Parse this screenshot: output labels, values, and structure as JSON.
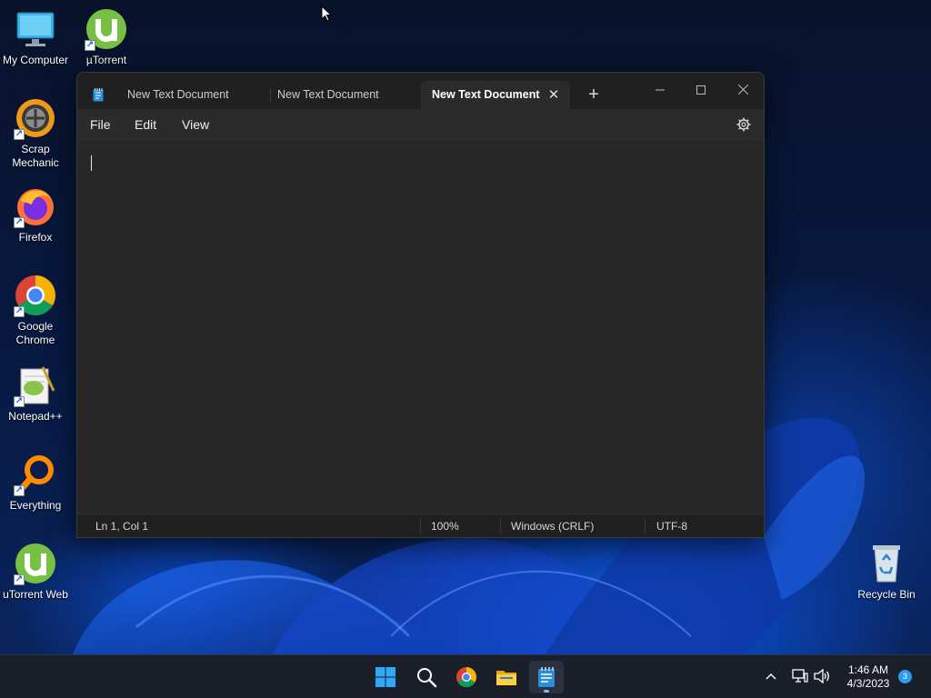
{
  "desktop": {
    "icons": [
      {
        "label": "My Computer",
        "icon": "computer-icon"
      },
      {
        "label": "µTorrent",
        "icon": "utorrent-icon"
      },
      {
        "label": "Scrap Mechanic",
        "icon": "scrap-mechanic-icon"
      },
      {
        "label": "Firefox",
        "icon": "firefox-icon"
      },
      {
        "label": "Google Chrome",
        "icon": "chrome-icon"
      },
      {
        "label": "Notepad++",
        "icon": "notepad-plus-plus-icon"
      },
      {
        "label": "Everything",
        "icon": "everything-search-icon"
      },
      {
        "label": "uTorrent Web",
        "icon": "utorrent-web-icon"
      },
      {
        "label": "Recycle Bin",
        "icon": "recycle-bin-icon"
      }
    ]
  },
  "notepad": {
    "tabs": [
      {
        "label": "New Text Document",
        "active": false
      },
      {
        "label": "New Text Document",
        "active": false
      },
      {
        "label": "New Text Document",
        "active": true
      }
    ],
    "menu": [
      "File",
      "Edit",
      "View"
    ],
    "content": "",
    "status": {
      "position": "Ln 1, Col 1",
      "zoom": "100%",
      "line_ending": "Windows (CRLF)",
      "encoding": "UTF-8"
    }
  },
  "taskbar": {
    "apps": [
      "start-icon",
      "search-icon",
      "chrome-icon",
      "file-explorer-icon",
      "notepad-icon"
    ],
    "active_app": "notepad-icon",
    "clock": {
      "time": "1:46 AM",
      "date": "4/3/2023"
    },
    "notifications": "3"
  },
  "colors": {
    "window_bg": "#202020",
    "editor_bg": "#272727",
    "taskbar_bg": "#1b1f2a",
    "accent": "#2e9bf0"
  }
}
